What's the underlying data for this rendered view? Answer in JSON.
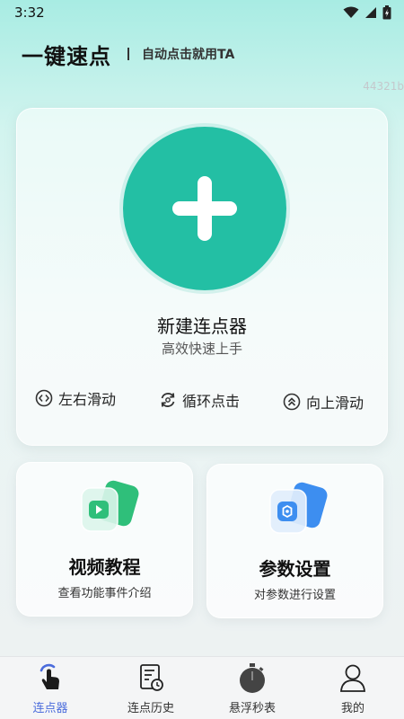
{
  "status_bar": {
    "time": "3:32",
    "icons": [
      "wifi-icon",
      "signal-icon",
      "battery-charging-icon"
    ]
  },
  "header": {
    "title": "一键速点",
    "tagline": "自动点击就用TA",
    "build_id": "44321b"
  },
  "main_card": {
    "add_icon": "plus-icon",
    "title": "新建连点器",
    "subtitle": "高效快速上手",
    "modes": [
      {
        "label": "左右滑动",
        "icon": "left-right-arrows-icon"
      },
      {
        "label": "循环点击",
        "icon": "loop-icon"
      },
      {
        "label": "向上滑动",
        "icon": "double-chevron-up-icon"
      }
    ]
  },
  "tiles": [
    {
      "title": "视频教程",
      "description": "查看功能事件介绍",
      "icon": "video-play-icon"
    },
    {
      "title": "参数设置",
      "description": "对参数进行设置",
      "icon": "settings-hexagon-icon"
    }
  ],
  "tab_bar": {
    "active_index": 0,
    "items": [
      {
        "label": "连点器",
        "icon": "tap-hand-icon"
      },
      {
        "label": "连点历史",
        "icon": "history-document-icon"
      },
      {
        "label": "悬浮秒表",
        "icon": "stopwatch-icon"
      },
      {
        "label": "我的",
        "icon": "user-icon"
      }
    ]
  },
  "colors": {
    "accent_teal": "#23bfa4",
    "video_green": "#2fbf7a",
    "settings_blue": "#3d8ef0",
    "tab_active": "#4b6cdc"
  }
}
